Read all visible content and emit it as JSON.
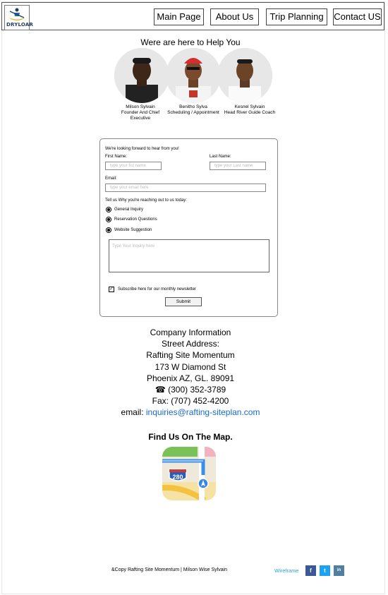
{
  "nav": {
    "logo_text": "DRYLOAR",
    "items": [
      {
        "label": "Main Page"
      },
      {
        "label": "About Us"
      },
      {
        "label": "Trip Planning"
      },
      {
        "label": "Contact US"
      }
    ]
  },
  "team": {
    "heading": "Were are here to Help You",
    "members": [
      {
        "name": "Milson Sylvain",
        "role": "Founder And Chief Executive"
      },
      {
        "name": "Benitho Sylva",
        "role": "Scheduling / Appointment"
      },
      {
        "name": "Kesnel Sylvain",
        "role": "Head River Guide Coach"
      }
    ]
  },
  "form": {
    "intro": "We're looking forward to hear from you!",
    "first_name_label": "First Name:",
    "first_name_placeholder": "type your fist name",
    "last_name_label": "Last Name:",
    "last_name_placeholder": "type your Last name",
    "email_label": "Email:",
    "email_placeholder": "type your email here",
    "reason_label": "Tell us Why you're reaching out to us today:",
    "options": [
      "General Inquiry",
      "Reservation Questions",
      "Website Suggestion"
    ],
    "inquiry_placeholder": "Type Your Inquiry here",
    "newsletter_label": "Subscribe here for our monthly newsletter",
    "newsletter_checked": "✓",
    "submit_label": "Submit"
  },
  "company": {
    "title": "Company Information",
    "street_label": "Street Address:",
    "site_name": "Rafting Site Momentum",
    "street": "173 W Diamond St",
    "city": "Phoenix AZ, GL. 89091",
    "phone": "(300) 352-3789",
    "phone_icon": "☎",
    "fax": "Fax: (707) 452-4200",
    "email_label": "email:",
    "email": "inquiries@rafting-siteplan.com"
  },
  "map": {
    "heading": "Find Us On The Map.",
    "route": "280"
  },
  "footer": {
    "copyright": "&Copy Rafting Site Momentum | Milson Wise Sylvain",
    "wireframe": "Wireframe",
    "social": [
      "f",
      "t",
      "in"
    ]
  },
  "colors": {
    "facebook": "#3b5998",
    "twitter": "#1da1f2",
    "instagram": "#517fa4",
    "link": "#1a6ac8"
  }
}
